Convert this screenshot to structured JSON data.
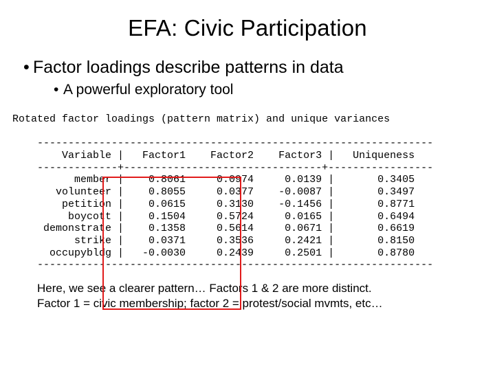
{
  "title": "EFA:  Civic Participation",
  "bullet1": "Factor loadings describe patterns in data",
  "bullet2": "A powerful exploratory tool",
  "table_header": "Rotated factor loadings (pattern matrix) and unique variances",
  "cols": {
    "var": "Variable",
    "f1": "Factor1",
    "f2": "Factor2",
    "f3": "Factor3",
    "uniq": "Uniqueness"
  },
  "rows": [
    {
      "var": "member",
      "f1": "0.8061",
      "f2": "0.0974",
      "f3": "0.0139",
      "uniq": "0.3405"
    },
    {
      "var": "volunteer",
      "f1": "0.8055",
      "f2": "0.0377",
      "f3": "-0.0087",
      "uniq": "0.3497"
    },
    {
      "var": "petition",
      "f1": "0.0615",
      "f2": "0.3130",
      "f3": "-0.1456",
      "uniq": "0.8771"
    },
    {
      "var": "boycott",
      "f1": "0.1504",
      "f2": "0.5724",
      "f3": "0.0165",
      "uniq": "0.6494"
    },
    {
      "var": "demonstrate",
      "f1": "0.1358",
      "f2": "0.5614",
      "f3": "0.0671",
      "uniq": "0.6619"
    },
    {
      "var": "strike",
      "f1": "0.0371",
      "f2": "0.3536",
      "f3": "0.2421",
      "uniq": "0.8150"
    },
    {
      "var": "occupybldg",
      "f1": "-0.0030",
      "f2": "0.2439",
      "f3": "0.2501",
      "uniq": "0.8780"
    }
  ],
  "caption1": "Here, we see a clearer pattern… Factors 1 & 2 are more distinct.",
  "caption2": "Factor 1 = civic membership; factor 2 = protest/social mvmts, etc…"
}
